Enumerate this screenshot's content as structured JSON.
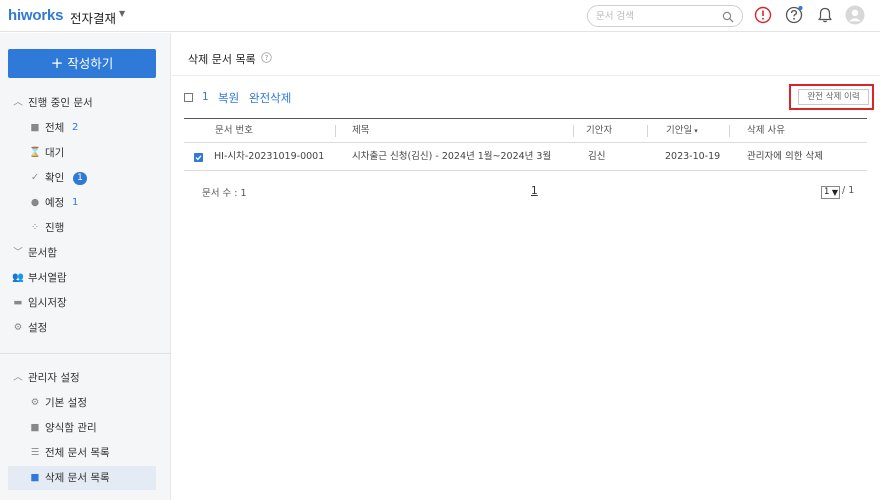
{
  "header": {
    "logo": "hiworks",
    "app_title": "전자결재",
    "search_placeholder": "문서 검색",
    "icons": [
      "chevron-down-icon",
      "search-icon",
      "alert-icon",
      "help-icon",
      "bell-icon",
      "avatar-icon"
    ],
    "alert_color": "#d9242a",
    "notification_dot_color": "#2f7ad8"
  },
  "sidebar": {
    "compose_label": "작성하기",
    "sections": {
      "in_progress": "진행 중인 문서",
      "doc_box": "문서함",
      "dept_view": "부서열람",
      "temp_save": "임시저장",
      "settings": "설정",
      "admin": "관리자 설정"
    },
    "items": {
      "all": {
        "label": "전체",
        "count": "2"
      },
      "waiting": {
        "label": "대기"
      },
      "confirm": {
        "label": "확인",
        "count": "1"
      },
      "scheduled": {
        "label": "예정",
        "count": "1"
      },
      "progress": {
        "label": "진행"
      },
      "basic_settings": {
        "label": "기본 설정"
      },
      "form_manage": {
        "label": "양식함 관리"
      },
      "all_docs": {
        "label": "전체 문서 목록"
      },
      "deleted_docs": {
        "label": "삭제 문서 목록"
      }
    }
  },
  "main": {
    "page_title": "삭제 문서 목록",
    "toolbar": {
      "selected_count": "1",
      "restore": "복원",
      "permanent_delete": "완전삭제",
      "history_button": "완전 삭제 이력"
    },
    "table": {
      "headers": {
        "doc_no": "문서 번호",
        "title": "제목",
        "drafter": "기안자",
        "draft_date": "기안일",
        "reason": "삭제 사유"
      },
      "sort_indicator": "▾",
      "rows": [
        {
          "checked": true,
          "doc_no": "HI-시차-20231019-0001",
          "title": "시차출근 신청(김신) - 2024년 1월~2024년 3월",
          "drafter": "김신",
          "draft_date": "2023-10-19",
          "reason": "관리자에 의한 삭제"
        }
      ]
    },
    "footer": {
      "doc_count": "문서 수 : 1",
      "current_page": "1",
      "page_select_value": "1",
      "page_total": "/ 1"
    }
  },
  "colors": {
    "accent": "#2f7ad8",
    "highlight_border": "#d9242a",
    "sidebar_bg": "#f4f6f8",
    "active_item_bg": "#e4ebf4"
  }
}
